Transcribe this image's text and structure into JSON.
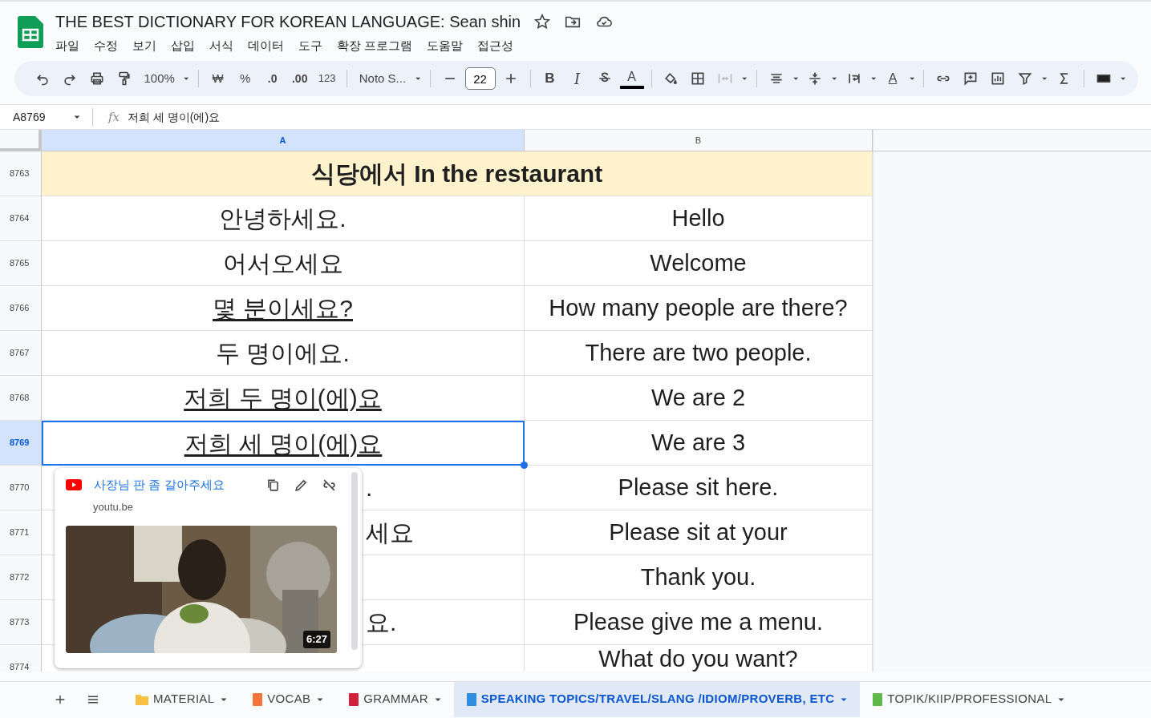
{
  "document": {
    "title": "THE BEST DICTIONARY FOR KOREAN LANGUAGE: Sean shin"
  },
  "menu": [
    "파일",
    "수정",
    "보기",
    "삽입",
    "서식",
    "데이터",
    "도구",
    "확장 프로그램",
    "도움말",
    "접근성"
  ],
  "toolbar": {
    "zoom": "100%",
    "currency": "₩",
    "percent": "%",
    "dec_decrease": ".0",
    "dec_increase": ".00",
    "more_formats": "123",
    "font": "Noto S...",
    "font_size": "22",
    "bold": "B",
    "italic": "I",
    "text_color": "A",
    "text_rotation": "A"
  },
  "formula_bar": {
    "cell": "A8769",
    "fx": "fx",
    "value": "저희 세 명이(에)요"
  },
  "columns": [
    "A",
    "B"
  ],
  "rows": [
    {
      "num": "8763",
      "kind": "heading",
      "a": "식당에서 In the restaurant",
      "selected": false
    },
    {
      "num": "8764",
      "kind": "pair",
      "a": "안녕하세요.",
      "b": "Hello",
      "link": false,
      "selected": false
    },
    {
      "num": "8765",
      "kind": "pair",
      "a": "어서오세요",
      "b": "Welcome",
      "link": false,
      "selected": false
    },
    {
      "num": "8766",
      "kind": "pair",
      "a": "몇 분이세요?",
      "b": "How many people are there?",
      "link": true,
      "selected": false
    },
    {
      "num": "8767",
      "kind": "pair",
      "a": "두 명이에요.",
      "b": "There are two people.",
      "link": false,
      "selected": false
    },
    {
      "num": "8768",
      "kind": "pair",
      "a": "저희 두 명이(에)요",
      "b": "We are 2",
      "link": true,
      "selected": false
    },
    {
      "num": "8769",
      "kind": "pair",
      "a": "저희 세 명이(에)요",
      "b": "We are 3",
      "link": true,
      "selected": true
    },
    {
      "num": "8770",
      "kind": "covered",
      "a": ".",
      "b": "Please sit here.",
      "link": false,
      "selected": false
    },
    {
      "num": "8771",
      "kind": "covered",
      "a": "세요",
      "b": "Please sit at your",
      "link": false,
      "selected": false
    },
    {
      "num": "8772",
      "kind": "covered",
      "b": "Thank you.",
      "selected": false
    },
    {
      "num": "8773",
      "kind": "covered",
      "a": "요.",
      "b": "Please give me a menu.",
      "link": false,
      "selected": false
    },
    {
      "num": "8774",
      "kind": "covered",
      "b": "What do you want?",
      "selected": false
    }
  ],
  "link_preview": {
    "title": "사장님 판 좀 갈아주세요",
    "domain": "youtu.be",
    "duration": "6:27"
  },
  "sheet_tabs": [
    {
      "label": "MATERIAL",
      "kind": "folder",
      "color": "#f6c142",
      "selected": false
    },
    {
      "label": "VOCAB",
      "kind": "book",
      "color": "#f4743b",
      "selected": false
    },
    {
      "label": "GRAMMAR",
      "kind": "book",
      "color": "#d21f3c",
      "selected": false
    },
    {
      "label": "SPEAKING TOPICS/TRAVEL/SLANG /IDIOM/PROVERB, ETC",
      "kind": "book",
      "color": "#2f8ee0",
      "selected": true
    },
    {
      "label": "TOPIK/KIIP/PROFESSIONAL",
      "kind": "book",
      "color": "#5fb84a",
      "selected": false
    }
  ]
}
